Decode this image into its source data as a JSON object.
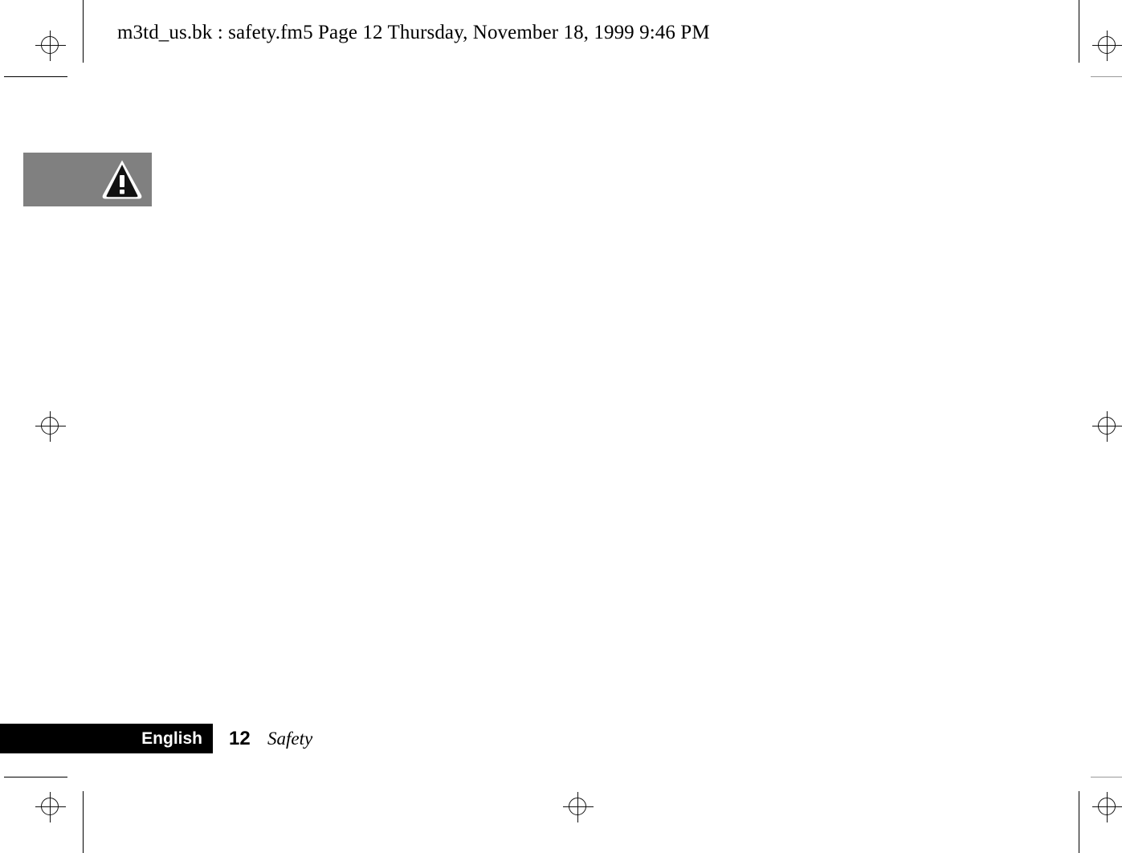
{
  "header": {
    "filename_line": "m3td_us.bk : safety.fm5  Page 12  Thursday, November 18, 1999  9:46 PM"
  },
  "callout": {
    "icon_name": "warning-triangle-icon",
    "background_color": "#808080"
  },
  "footer": {
    "language_label": "English",
    "page_number": "12",
    "section_label": "Safety",
    "bar_color": "#000000",
    "language_text_color": "#ffffff"
  },
  "print_marks": {
    "registration_mark_name": "registration-target-mark",
    "crop_mark_name": "crop-mark",
    "mark_color": "#111111"
  }
}
